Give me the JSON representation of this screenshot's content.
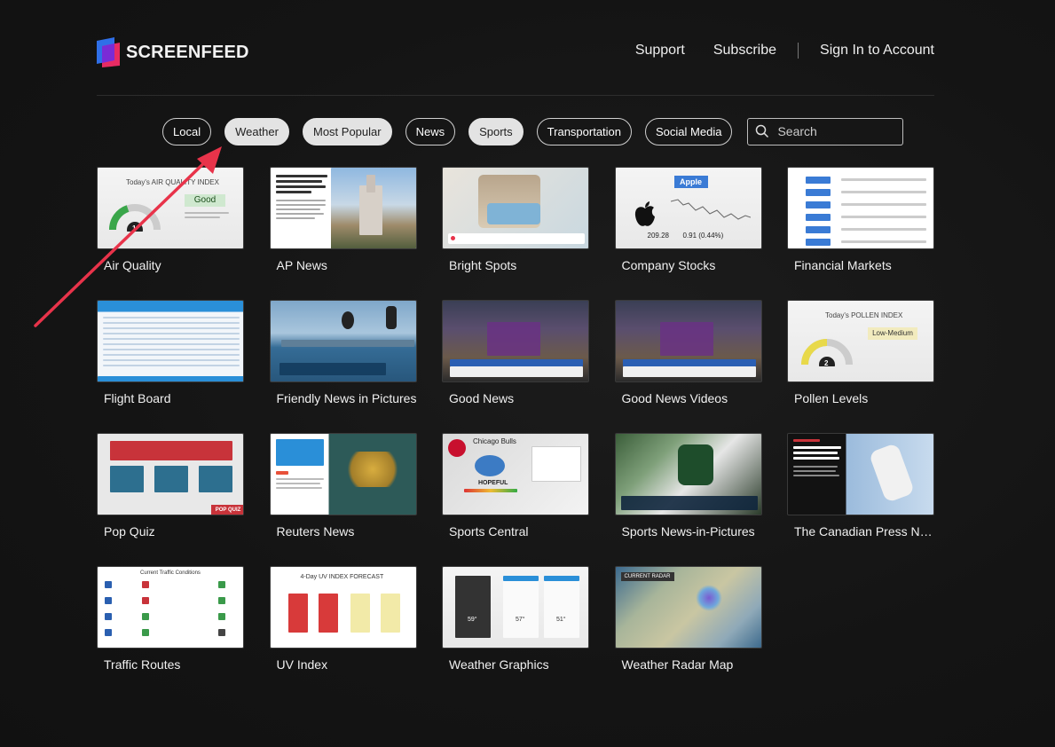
{
  "brand": {
    "name": "SCREENFEED"
  },
  "nav": {
    "support": "Support",
    "subscribe": "Subscribe",
    "signin": "Sign In to Account"
  },
  "filters": [
    {
      "label": "Local",
      "selected": false
    },
    {
      "label": "Weather",
      "selected": true
    },
    {
      "label": "Most Popular",
      "selected": true
    },
    {
      "label": "News",
      "selected": false
    },
    {
      "label": "Sports",
      "selected": true
    },
    {
      "label": "Transportation",
      "selected": false
    },
    {
      "label": "Social Media",
      "selected": false
    }
  ],
  "search": {
    "placeholder": "Search"
  },
  "cards": [
    {
      "title": "Air Quality"
    },
    {
      "title": "AP News"
    },
    {
      "title": "Bright Spots"
    },
    {
      "title": "Company Stocks"
    },
    {
      "title": "Financial Markets"
    },
    {
      "title": "Flight Board"
    },
    {
      "title": "Friendly News in Pictures"
    },
    {
      "title": "Good News"
    },
    {
      "title": "Good News Videos"
    },
    {
      "title": "Pollen Levels"
    },
    {
      "title": "Pop Quiz"
    },
    {
      "title": "Reuters News"
    },
    {
      "title": "Sports Central"
    },
    {
      "title": "Sports News-in-Pictures"
    },
    {
      "title": "The Canadian Press News"
    },
    {
      "title": "Traffic Routes"
    },
    {
      "title": "UV Index"
    },
    {
      "title": "Weather Graphics"
    },
    {
      "title": "Weather Radar Map"
    }
  ],
  "thumbs": {
    "air": {
      "heading": "Today's AIR QUALITY INDEX",
      "value": "Good",
      "level": "1"
    },
    "stock": {
      "name": "Apple",
      "price": "209.28",
      "change": "0.91 (0.44%)"
    },
    "pollen": {
      "heading": "Today's POLLEN INDEX",
      "value": "Low-Medium",
      "level": "2"
    },
    "sports": {
      "team": "Chicago Bulls",
      "mood": "HOPEFUL"
    },
    "uv": {
      "heading": "4-Day UV INDEX FORECAST"
    },
    "radar": {
      "label": "CURRENT RADAR"
    },
    "traffic": {
      "heading": "Current Traffic Conditions"
    },
    "quiz": {
      "tag": "POP QUIZ"
    },
    "weather": {
      "temps": [
        "59°",
        "57°",
        "51°"
      ]
    }
  },
  "colors": {
    "accent_arrow": "#e8334a",
    "bg": "#141414"
  }
}
